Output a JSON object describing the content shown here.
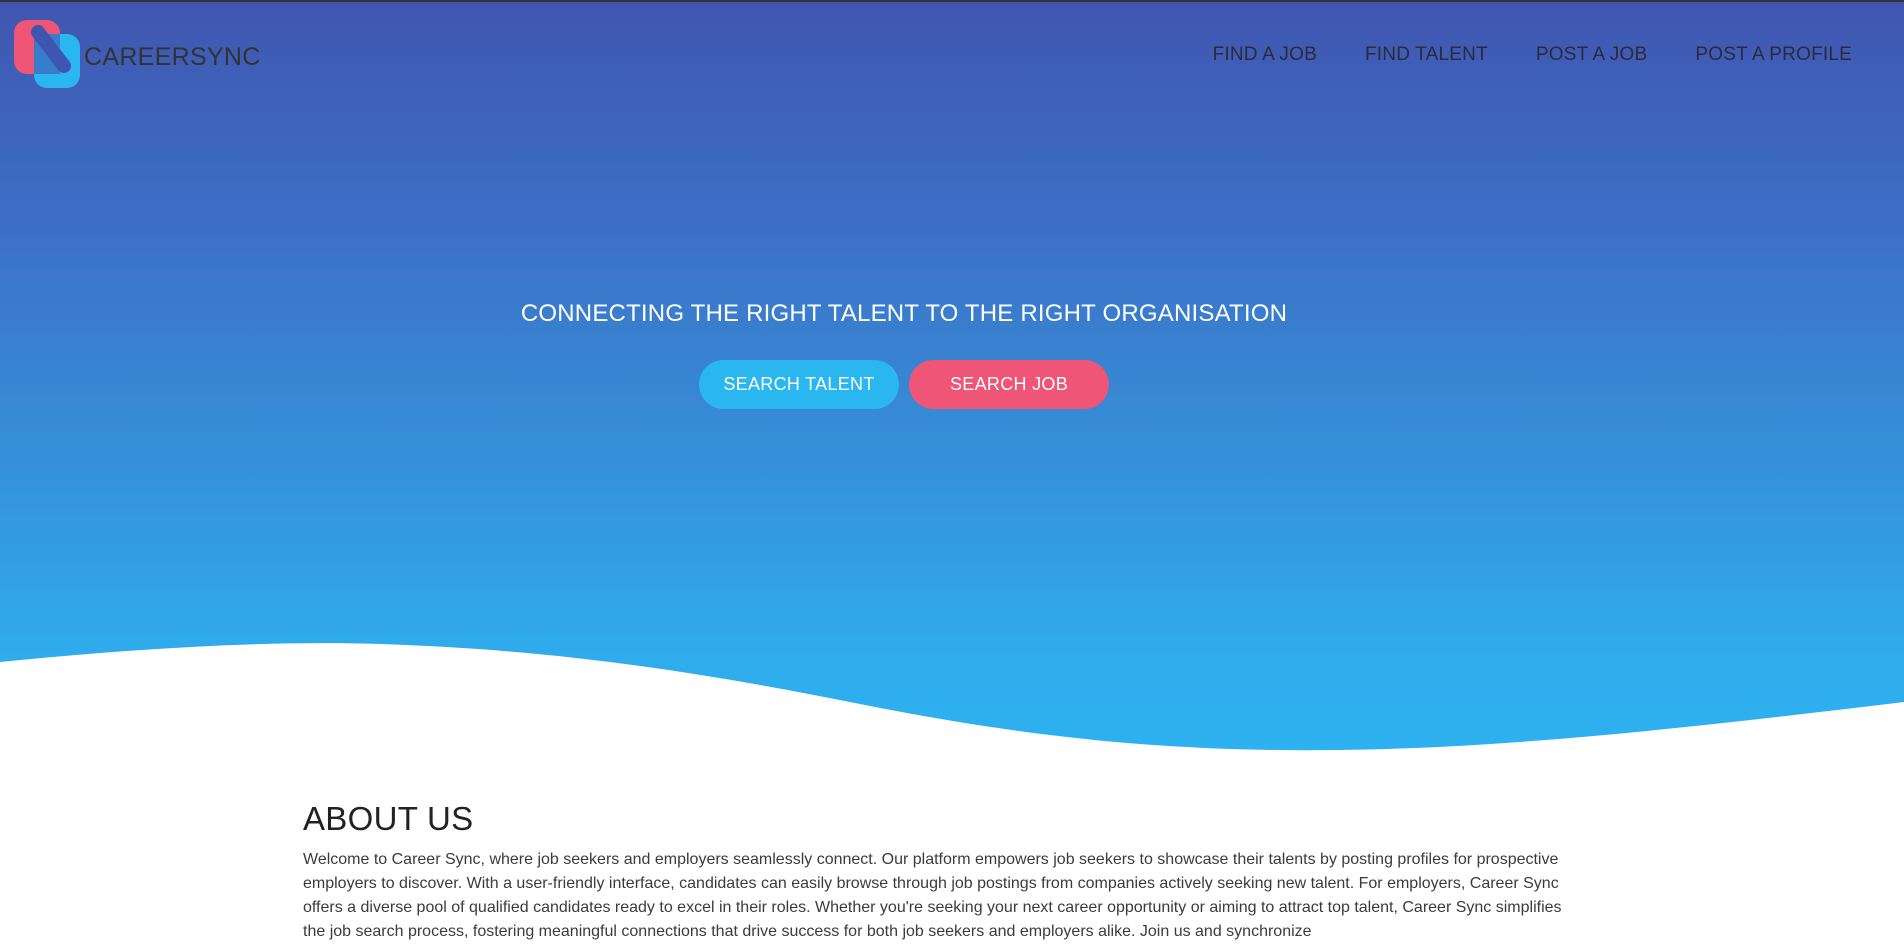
{
  "brand": {
    "name": "CAREERSYNC",
    "logo_icon": "careersync-logo-icon",
    "colors": {
      "pink": "#ef5577",
      "blue": "#2ab7f0"
    }
  },
  "nav": {
    "items": [
      {
        "label": "FIND A JOB"
      },
      {
        "label": "FIND TALENT"
      },
      {
        "label": "POST A JOB"
      },
      {
        "label": "POST A PROFILE"
      }
    ]
  },
  "hero": {
    "tagline": "CONNECTING THE RIGHT TALENT TO THE RIGHT ORGANISATION",
    "buttons": {
      "search_talent": "SEARCH TALENT",
      "search_job": "SEARCH JOB"
    },
    "colors": {
      "gradient_top": "#4056b0",
      "gradient_bottom": "#2eb2f0"
    }
  },
  "about": {
    "title": "ABOUT US",
    "text": "Welcome to Career Sync, where job seekers and employers seamlessly connect. Our platform empowers job seekers to showcase their talents by posting profiles for prospective employers to discover. With a user-friendly interface, candidates can easily browse through job postings from companies actively seeking new talent. For employers, Career Sync offers a diverse pool of qualified candidates ready to excel in their roles. Whether you're seeking your next career opportunity or aiming to attract top talent, Career Sync simplifies the job search process, fostering meaningful connections that drive success for both job seekers and employers alike. Join us and synchronize"
  }
}
